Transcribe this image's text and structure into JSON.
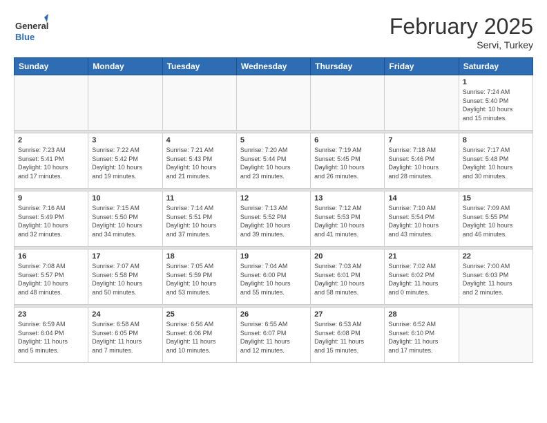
{
  "header": {
    "logo": {
      "general": "General",
      "blue": "Blue"
    },
    "title": "February 2025",
    "location": "Servi, Turkey"
  },
  "weekdays": [
    "Sunday",
    "Monday",
    "Tuesday",
    "Wednesday",
    "Thursday",
    "Friday",
    "Saturday"
  ],
  "weeks": [
    [
      {
        "day": "",
        "info": ""
      },
      {
        "day": "",
        "info": ""
      },
      {
        "day": "",
        "info": ""
      },
      {
        "day": "",
        "info": ""
      },
      {
        "day": "",
        "info": ""
      },
      {
        "day": "",
        "info": ""
      },
      {
        "day": "1",
        "info": "Sunrise: 7:24 AM\nSunset: 5:40 PM\nDaylight: 10 hours\nand 15 minutes."
      }
    ],
    [
      {
        "day": "2",
        "info": "Sunrise: 7:23 AM\nSunset: 5:41 PM\nDaylight: 10 hours\nand 17 minutes."
      },
      {
        "day": "3",
        "info": "Sunrise: 7:22 AM\nSunset: 5:42 PM\nDaylight: 10 hours\nand 19 minutes."
      },
      {
        "day": "4",
        "info": "Sunrise: 7:21 AM\nSunset: 5:43 PM\nDaylight: 10 hours\nand 21 minutes."
      },
      {
        "day": "5",
        "info": "Sunrise: 7:20 AM\nSunset: 5:44 PM\nDaylight: 10 hours\nand 23 minutes."
      },
      {
        "day": "6",
        "info": "Sunrise: 7:19 AM\nSunset: 5:45 PM\nDaylight: 10 hours\nand 26 minutes."
      },
      {
        "day": "7",
        "info": "Sunrise: 7:18 AM\nSunset: 5:46 PM\nDaylight: 10 hours\nand 28 minutes."
      },
      {
        "day": "8",
        "info": "Sunrise: 7:17 AM\nSunset: 5:48 PM\nDaylight: 10 hours\nand 30 minutes."
      }
    ],
    [
      {
        "day": "9",
        "info": "Sunrise: 7:16 AM\nSunset: 5:49 PM\nDaylight: 10 hours\nand 32 minutes."
      },
      {
        "day": "10",
        "info": "Sunrise: 7:15 AM\nSunset: 5:50 PM\nDaylight: 10 hours\nand 34 minutes."
      },
      {
        "day": "11",
        "info": "Sunrise: 7:14 AM\nSunset: 5:51 PM\nDaylight: 10 hours\nand 37 minutes."
      },
      {
        "day": "12",
        "info": "Sunrise: 7:13 AM\nSunset: 5:52 PM\nDaylight: 10 hours\nand 39 minutes."
      },
      {
        "day": "13",
        "info": "Sunrise: 7:12 AM\nSunset: 5:53 PM\nDaylight: 10 hours\nand 41 minutes."
      },
      {
        "day": "14",
        "info": "Sunrise: 7:10 AM\nSunset: 5:54 PM\nDaylight: 10 hours\nand 43 minutes."
      },
      {
        "day": "15",
        "info": "Sunrise: 7:09 AM\nSunset: 5:55 PM\nDaylight: 10 hours\nand 46 minutes."
      }
    ],
    [
      {
        "day": "16",
        "info": "Sunrise: 7:08 AM\nSunset: 5:57 PM\nDaylight: 10 hours\nand 48 minutes."
      },
      {
        "day": "17",
        "info": "Sunrise: 7:07 AM\nSunset: 5:58 PM\nDaylight: 10 hours\nand 50 minutes."
      },
      {
        "day": "18",
        "info": "Sunrise: 7:05 AM\nSunset: 5:59 PM\nDaylight: 10 hours\nand 53 minutes."
      },
      {
        "day": "19",
        "info": "Sunrise: 7:04 AM\nSunset: 6:00 PM\nDaylight: 10 hours\nand 55 minutes."
      },
      {
        "day": "20",
        "info": "Sunrise: 7:03 AM\nSunset: 6:01 PM\nDaylight: 10 hours\nand 58 minutes."
      },
      {
        "day": "21",
        "info": "Sunrise: 7:02 AM\nSunset: 6:02 PM\nDaylight: 11 hours\nand 0 minutes."
      },
      {
        "day": "22",
        "info": "Sunrise: 7:00 AM\nSunset: 6:03 PM\nDaylight: 11 hours\nand 2 minutes."
      }
    ],
    [
      {
        "day": "23",
        "info": "Sunrise: 6:59 AM\nSunset: 6:04 PM\nDaylight: 11 hours\nand 5 minutes."
      },
      {
        "day": "24",
        "info": "Sunrise: 6:58 AM\nSunset: 6:05 PM\nDaylight: 11 hours\nand 7 minutes."
      },
      {
        "day": "25",
        "info": "Sunrise: 6:56 AM\nSunset: 6:06 PM\nDaylight: 11 hours\nand 10 minutes."
      },
      {
        "day": "26",
        "info": "Sunrise: 6:55 AM\nSunset: 6:07 PM\nDaylight: 11 hours\nand 12 minutes."
      },
      {
        "day": "27",
        "info": "Sunrise: 6:53 AM\nSunset: 6:08 PM\nDaylight: 11 hours\nand 15 minutes."
      },
      {
        "day": "28",
        "info": "Sunrise: 6:52 AM\nSunset: 6:10 PM\nDaylight: 11 hours\nand 17 minutes."
      },
      {
        "day": "",
        "info": ""
      }
    ]
  ]
}
